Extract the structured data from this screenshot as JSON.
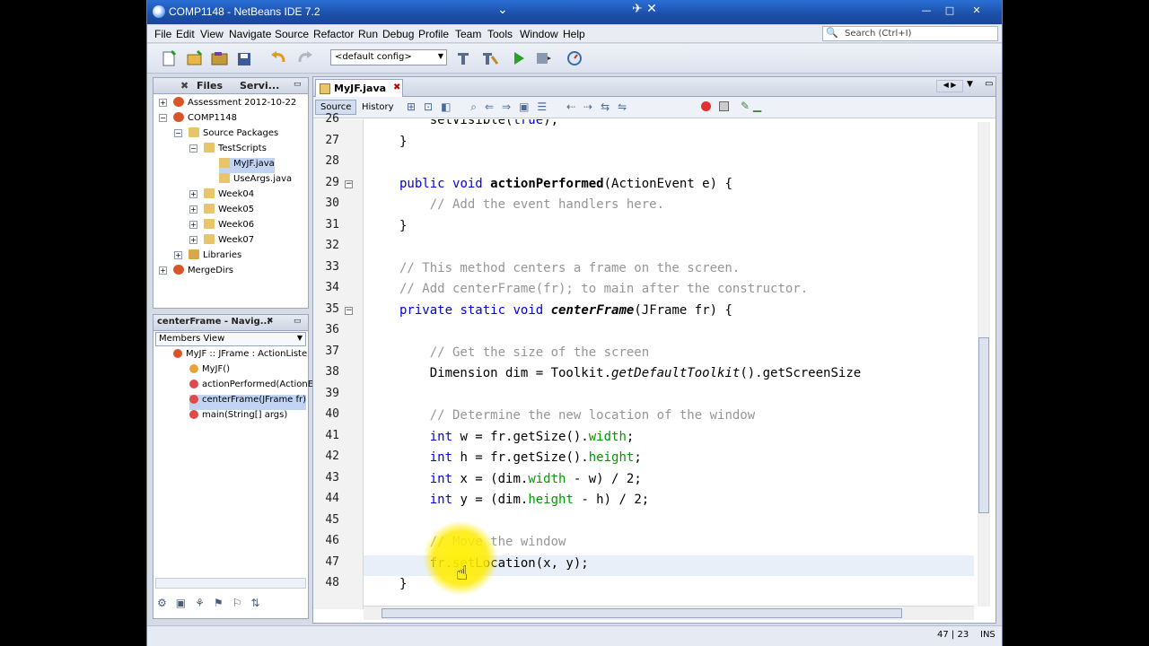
{
  "window": {
    "title": "COMP1148 - NetBeans IDE 7.2",
    "minimize": "—",
    "maximize": "□",
    "close": "✕"
  },
  "menubar": {
    "items": [
      "File",
      "Edit",
      "View",
      "Navigate",
      "Source",
      "Refactor",
      "Run",
      "Debug",
      "Profile",
      "Team",
      "Tools",
      "Window",
      "Help"
    ],
    "search_placeholder": "Search (Ctrl+I)"
  },
  "toolbar": {
    "config": "<default config>"
  },
  "projects_pane": {
    "tabs": [
      "Files",
      "Servi..."
    ],
    "tree": [
      {
        "label": "Assessment 2012-10-22",
        "icon": "project-icon",
        "depth": 0
      },
      {
        "label": "COMP1148",
        "icon": "project-icon",
        "depth": 0
      },
      {
        "label": "Source Packages",
        "icon": "folder-icon",
        "depth": 1
      },
      {
        "label": "TestScripts",
        "icon": "package-icon",
        "depth": 2
      },
      {
        "label": "MyJF.java",
        "icon": "java-file-icon",
        "depth": 3,
        "selected": true
      },
      {
        "label": "UseArgs.java",
        "icon": "java-file-icon",
        "depth": 3
      },
      {
        "label": "Week04",
        "icon": "package-icon",
        "depth": 2
      },
      {
        "label": "Week05",
        "icon": "package-icon",
        "depth": 2
      },
      {
        "label": "Week06",
        "icon": "package-icon",
        "depth": 2
      },
      {
        "label": "Week07",
        "icon": "package-icon",
        "depth": 2
      },
      {
        "label": "Libraries",
        "icon": "library-icon",
        "depth": 1
      },
      {
        "label": "MergeDirs",
        "icon": "project-icon",
        "depth": 0
      }
    ]
  },
  "navigator_pane": {
    "title": "centerFrame - Navig...",
    "view": "Members View",
    "items": [
      {
        "label": "MyJF :: JFrame : ActionListe",
        "depth": 0
      },
      {
        "label": "MyJF()",
        "depth": 1
      },
      {
        "label": "actionPerformed(ActionE",
        "depth": 1
      },
      {
        "label": "centerFrame(JFrame fr)",
        "depth": 1,
        "selected": true
      },
      {
        "label": "main(String[] args)",
        "depth": 1
      }
    ]
  },
  "editor": {
    "tab": "MyJF.java",
    "tab_close": "✖",
    "source_button": "Source",
    "history_button": "History",
    "lines": [
      {
        "n": "26",
        "code": "    setVisible(true);"
      },
      {
        "n": "27",
        "code": "}"
      },
      {
        "n": "28",
        "code": ""
      },
      {
        "n": "29",
        "code": "public void actionPerformed(ActionEvent e) {"
      },
      {
        "n": "30",
        "code": "    // Add the event handlers here."
      },
      {
        "n": "31",
        "code": "}"
      },
      {
        "n": "32",
        "code": ""
      },
      {
        "n": "33",
        "code": "// This method centers a frame on the screen."
      },
      {
        "n": "34",
        "code": "// Add centerFrame(fr); to main after the constructor."
      },
      {
        "n": "35",
        "code": "private static void centerFrame(JFrame fr) {"
      },
      {
        "n": "36",
        "code": ""
      },
      {
        "n": "37",
        "code": "    // Get the size of the screen"
      },
      {
        "n": "38",
        "code": "    Dimension dim = Toolkit.getDefaultToolkit().getScreenSize"
      },
      {
        "n": "39",
        "code": ""
      },
      {
        "n": "40",
        "code": "    // Determine the new location of the window"
      },
      {
        "n": "41",
        "code": "    int w = fr.getSize().width;"
      },
      {
        "n": "42",
        "code": "    int h = fr.getSize().height;"
      },
      {
        "n": "43",
        "code": "    int x = (dim.width - w) / 2;"
      },
      {
        "n": "44",
        "code": "    int y = (dim.height - h) / 2;"
      },
      {
        "n": "45",
        "code": ""
      },
      {
        "n": "46",
        "code": "    // Move the window"
      },
      {
        "n": "47",
        "code": "    fr.setLocation(x, y);"
      },
      {
        "n": "48",
        "code": "}"
      }
    ]
  },
  "statusbar": {
    "position": "47 | 23",
    "mode": "INS"
  }
}
